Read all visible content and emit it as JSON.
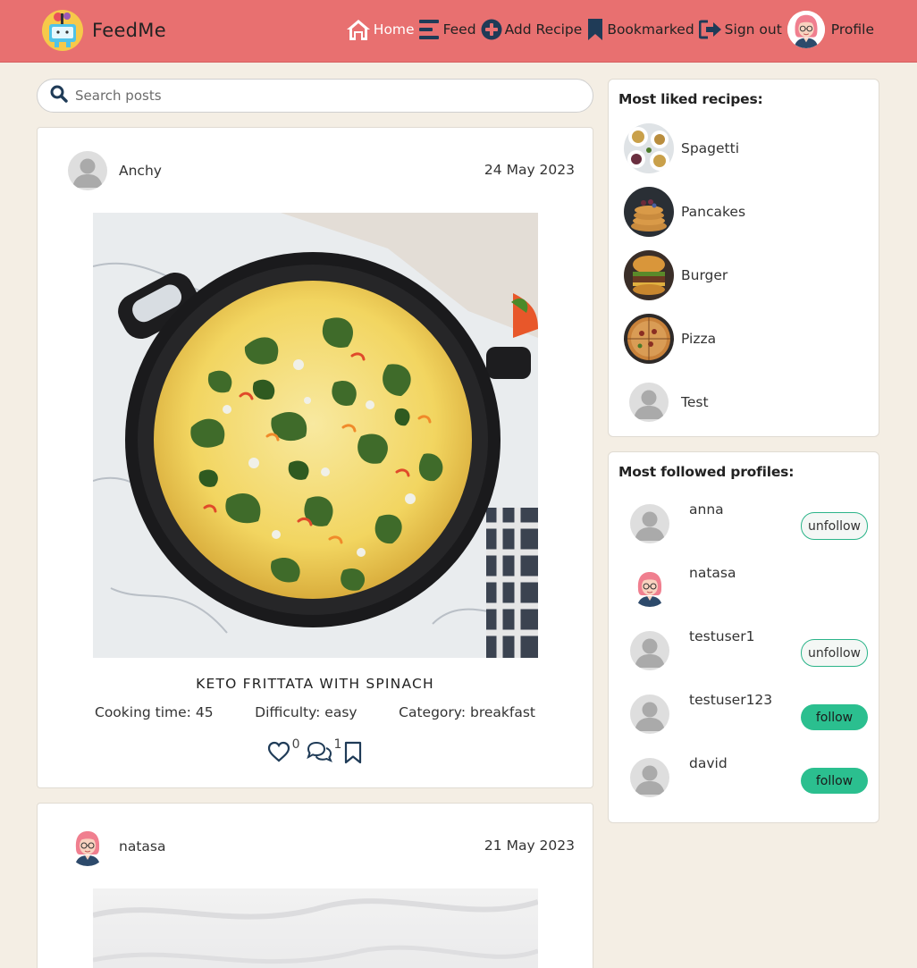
{
  "app": {
    "name": "FeedMe"
  },
  "nav": {
    "home": "Home",
    "feed": "Feed",
    "add_recipe": "Add Recipe",
    "bookmarked": "Bookmarked",
    "sign_out": "Sign out",
    "profile": "Profile"
  },
  "search": {
    "placeholder": "Search posts",
    "value": ""
  },
  "posts": [
    {
      "author": "Anchy",
      "date": "24 May 2023",
      "title": "KETO FRITTATA WITH SPINACH",
      "cooking_time": "Cooking time: 45",
      "difficulty": "Difficulty: easy",
      "category": "Category: breakfast",
      "likes": "0",
      "comments": "1"
    },
    {
      "author": "natasa",
      "date": "21 May 2023"
    }
  ],
  "sidebar": {
    "liked_title": "Most liked recipes:",
    "liked": [
      "Spagetti",
      "Pancakes",
      "Burger",
      "Pizza",
      "Test"
    ],
    "followed_title": "Most followed profiles:",
    "profiles": [
      {
        "name": "anna",
        "action": "unfollow"
      },
      {
        "name": "natasa",
        "action": ""
      },
      {
        "name": "testuser1",
        "action": "unfollow"
      },
      {
        "name": "testuser123",
        "action": "follow"
      },
      {
        "name": "david",
        "action": "follow"
      }
    ]
  },
  "colors": {
    "navbar": "#e87070",
    "background": "#f4eee4",
    "follow": "#2bbf8f",
    "accent_dark": "#1f3b57"
  }
}
